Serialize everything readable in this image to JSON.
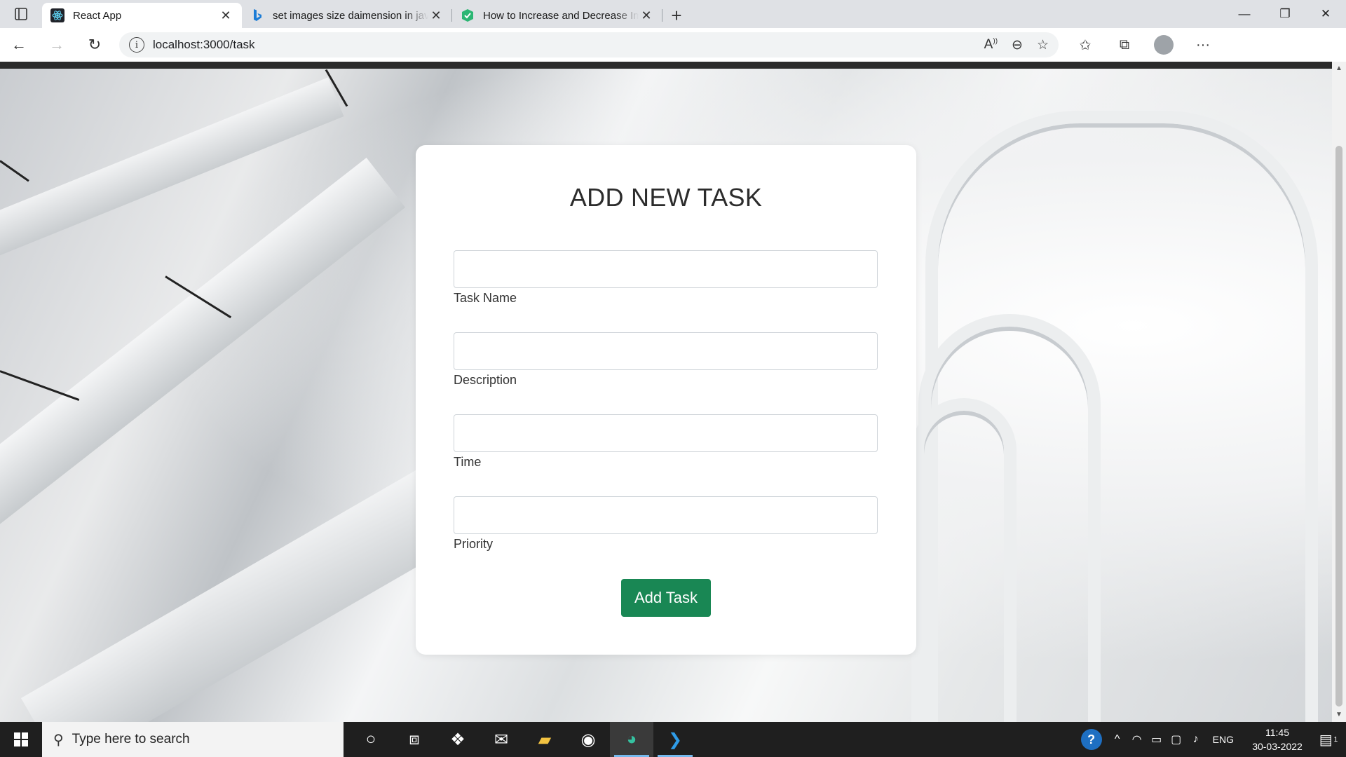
{
  "browser": {
    "tabs": [
      {
        "title": "React App",
        "active": true,
        "favicon": "react-icon"
      },
      {
        "title": "set images size daimension in javascript",
        "active": false,
        "favicon": "bing-icon"
      },
      {
        "title": "How to Increase and Decrease Image Size",
        "active": false,
        "favicon": "shield-icon"
      }
    ],
    "url": "localhost:3000/task"
  },
  "form": {
    "title": "ADD NEW TASK",
    "fields": [
      {
        "label": "Task Name",
        "value": ""
      },
      {
        "label": "Description",
        "value": ""
      },
      {
        "label": "Time",
        "value": ""
      },
      {
        "label": "Priority",
        "value": ""
      }
    ],
    "submit_label": "Add Task",
    "submit_color": "#198754"
  },
  "taskbar": {
    "search_placeholder": "Type here to search",
    "language": "ENG",
    "time": "11:45",
    "date": "30-03-2022",
    "notification_count": "1"
  },
  "colors": {
    "accent": "#198754",
    "taskbar": "#1f1f1f"
  }
}
